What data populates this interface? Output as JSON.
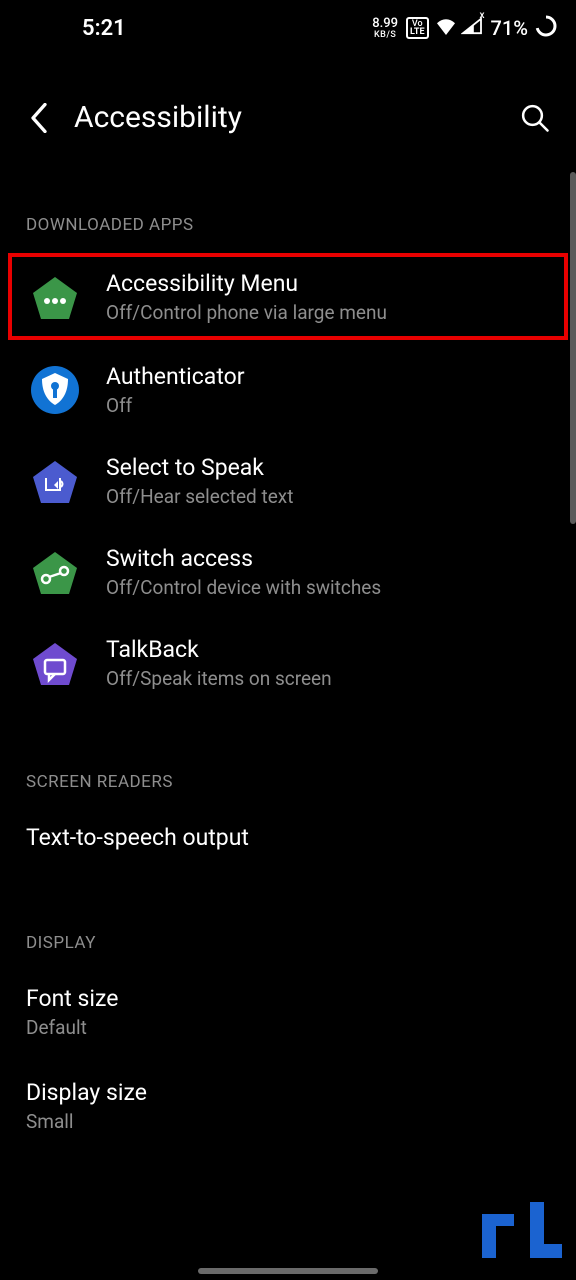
{
  "status": {
    "time": "5:21",
    "data_rate": "8.99",
    "data_unit": "KB/S",
    "lte_top": "Vo",
    "lte_bot": "LTE",
    "battery": "71%"
  },
  "header": {
    "title": "Accessibility"
  },
  "sections": {
    "downloaded": {
      "header": "DOWNLOADED APPS",
      "items": [
        {
          "title": "Accessibility Menu",
          "sub": "Off/Control phone via large menu"
        },
        {
          "title": "Authenticator",
          "sub": "Off"
        },
        {
          "title": "Select to Speak",
          "sub": "Off/Hear selected text"
        },
        {
          "title": "Switch access",
          "sub": "Off/Control device with switches"
        },
        {
          "title": "TalkBack",
          "sub": "Off/Speak items on screen"
        }
      ]
    },
    "screen_readers": {
      "header": "SCREEN READERS",
      "items": [
        {
          "title": "Text-to-speech output"
        }
      ]
    },
    "display": {
      "header": "DISPLAY",
      "items": [
        {
          "title": "Font size",
          "sub": "Default"
        },
        {
          "title": "Display size",
          "sub": "Small"
        }
      ]
    }
  }
}
